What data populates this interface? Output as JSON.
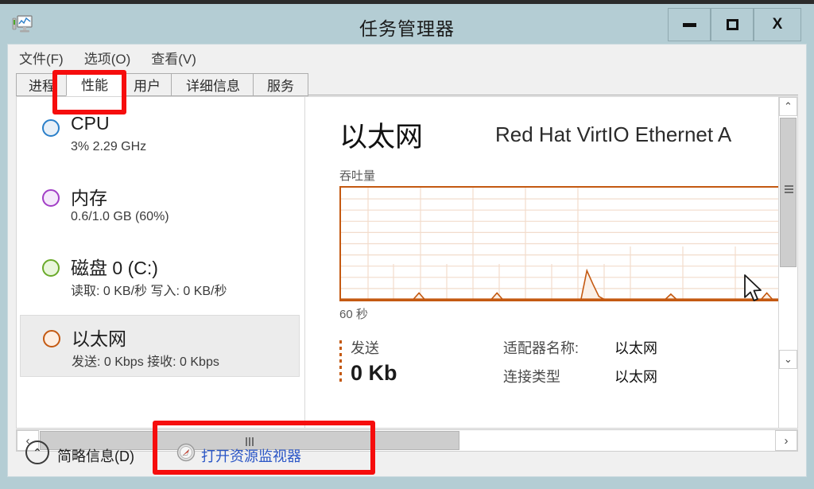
{
  "window": {
    "title": "任务管理器",
    "icon": "task-manager-icon",
    "controls": {
      "minimize": "–",
      "maximize": "□",
      "close": "X"
    }
  },
  "menubar": {
    "items": [
      {
        "label": "文件(F)"
      },
      {
        "label": "选项(O)"
      },
      {
        "label": "查看(V)"
      }
    ]
  },
  "tabs": [
    {
      "label": "进程",
      "active": false
    },
    {
      "label": "性能",
      "active": true
    },
    {
      "label": "用户",
      "active": false
    },
    {
      "label": "详细信息",
      "active": false
    },
    {
      "label": "服务",
      "active": false
    }
  ],
  "resources": [
    {
      "name": "CPU",
      "sub": "3% 2.29 GHz",
      "color": "#2a7fc9",
      "fill": "#e8f0f8",
      "selected": false
    },
    {
      "name": "内存",
      "sub": "0.6/1.0 GB (60%)",
      "color": "#a23fc6",
      "fill": "#f5e9fb",
      "selected": false
    },
    {
      "name": "磁盘 0 (C:)",
      "sub": "读取: 0 KB/秒 写入: 0 KB/秒",
      "color": "#6aaa2a",
      "fill": "#e9f6dc",
      "selected": false
    },
    {
      "name": "以太网",
      "sub": "发送: 0 Kbps 接收: 0 Kbps",
      "color": "#c45911",
      "fill": "#fdeee2",
      "selected": true
    }
  ],
  "detail": {
    "title": "以太网",
    "adapter_model": "Red Hat VirtIO Ethernet A",
    "graph_label": "吞吐量",
    "graph_seconds": "60 秒",
    "legend": {
      "send_label": "发送",
      "send_value": "0 Kb"
    },
    "info_rows": [
      {
        "key": "适配器名称:",
        "value": "以太网"
      },
      {
        "key": "连接类型",
        "value": "以太网"
      }
    ]
  },
  "chart_data": {
    "type": "area",
    "title": "吞吐量",
    "xlabel": "60 秒",
    "ylabel": "",
    "ylim": [
      0,
      100
    ],
    "grid": true,
    "grid_rows": 10,
    "accent_color": "#c45911",
    "series": [
      {
        "name": "发送",
        "points": [
          0,
          0,
          0,
          0,
          0,
          0,
          0,
          0,
          0,
          0,
          0,
          0,
          0,
          6,
          0,
          0,
          0,
          0,
          0,
          0,
          0,
          0,
          0,
          0,
          0,
          0,
          6,
          0,
          0,
          0,
          0,
          0,
          0,
          0,
          0,
          0,
          0,
          0,
          0,
          0,
          0,
          26,
          14,
          3,
          0,
          0,
          0,
          0,
          0,
          0,
          0,
          0,
          0,
          0,
          0,
          5,
          0,
          0,
          0,
          0,
          0,
          0,
          0,
          0,
          0,
          0,
          0,
          0,
          0,
          0,
          0,
          6,
          0,
          0,
          0,
          0,
          0,
          0,
          0,
          0
        ]
      }
    ]
  },
  "scrollbars": {
    "vertical": {
      "up": "⌃",
      "down": "⌄"
    },
    "horizontal": {
      "left": "‹",
      "right": "›"
    }
  },
  "statusbar": {
    "fewer_details_label": "简略信息(D)",
    "chevron": "⌃",
    "resource_monitor_label": "打开资源监视器",
    "resource_monitor_icon": "resource-monitor-icon"
  },
  "annotations": [
    {
      "name": "annotation-tab-performance",
      "color": "#f60d0d"
    },
    {
      "name": "annotation-open-resource-monitor",
      "color": "#f60d0d"
    }
  ]
}
